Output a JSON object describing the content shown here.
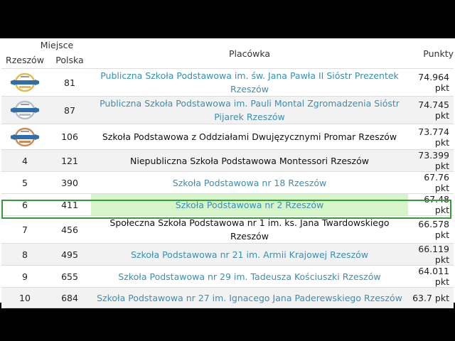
{
  "header": {
    "miejsce": "Miejsce",
    "rzeszow": "Rzeszów",
    "polska": "Polska",
    "placowka": "Placówka",
    "punkty": "Punkty"
  },
  "badge_colors": {
    "gold": "#e8b84a",
    "silver": "#b8bcc4",
    "bronze": "#c98a55",
    "ribbon": "#2f6ea8"
  },
  "rows": [
    {
      "rank": "",
      "badge": "gold",
      "polska": "81",
      "name": "Publiczna Szkoła Podstawowa im. św. Jana Pawła II Sióstr Prezentek Rzeszów",
      "link": true,
      "points": "74.964 pkt"
    },
    {
      "rank": "",
      "badge": "silver",
      "polska": "87",
      "name": "Publiczna Szkoła Podstawowa im. Pauli Montal Zgromadzenia Sióstr Pijarek Rzeszów",
      "link": true,
      "points": "74.745 pkt"
    },
    {
      "rank": "",
      "badge": "bronze",
      "polska": "106",
      "name": "Szkoła Podstawowa z Oddziałami Dwujęzycznymi Promar Rzeszów",
      "link": false,
      "points": "73.774 pkt"
    },
    {
      "rank": "4",
      "polska": "121",
      "name": "Niepubliczna Szkoła Podstawowa Montessori Rzeszów",
      "link": false,
      "points": "73.399 pkt"
    },
    {
      "rank": "5",
      "polska": "390",
      "name": "Szkoła Podstawowa nr 18 Rzeszów",
      "link": true,
      "points": "67.76 pkt"
    },
    {
      "rank": "6",
      "polska": "411",
      "name": "Szkoła Podstawowa nr 2 Rzeszów",
      "link": true,
      "points": "67.48 pkt",
      "highlight": true
    },
    {
      "rank": "7",
      "polska": "456",
      "name": "Społeczna Szkoła Podstawowa nr 1 im. ks. Jana Twardowskiego Rzeszów",
      "link": false,
      "points": "66.578 pkt"
    },
    {
      "rank": "8",
      "polska": "495",
      "name": "Szkoła Podstawowa nr 21 im. Armii Krajowej Rzeszów",
      "link": true,
      "points": "66.119 pkt"
    },
    {
      "rank": "9",
      "polska": "655",
      "name": "Szkoła Podstawowa nr 29 im. Tadeusza Kościuszki Rzeszów",
      "link": true,
      "points": "64.011 pkt"
    },
    {
      "rank": "10",
      "polska": "684",
      "name": "Szkoła Podstawowa nr 27 im. Ignacego Jana Paderewskiego Rzeszów",
      "link": true,
      "points": "63.7 pkt"
    }
  ]
}
